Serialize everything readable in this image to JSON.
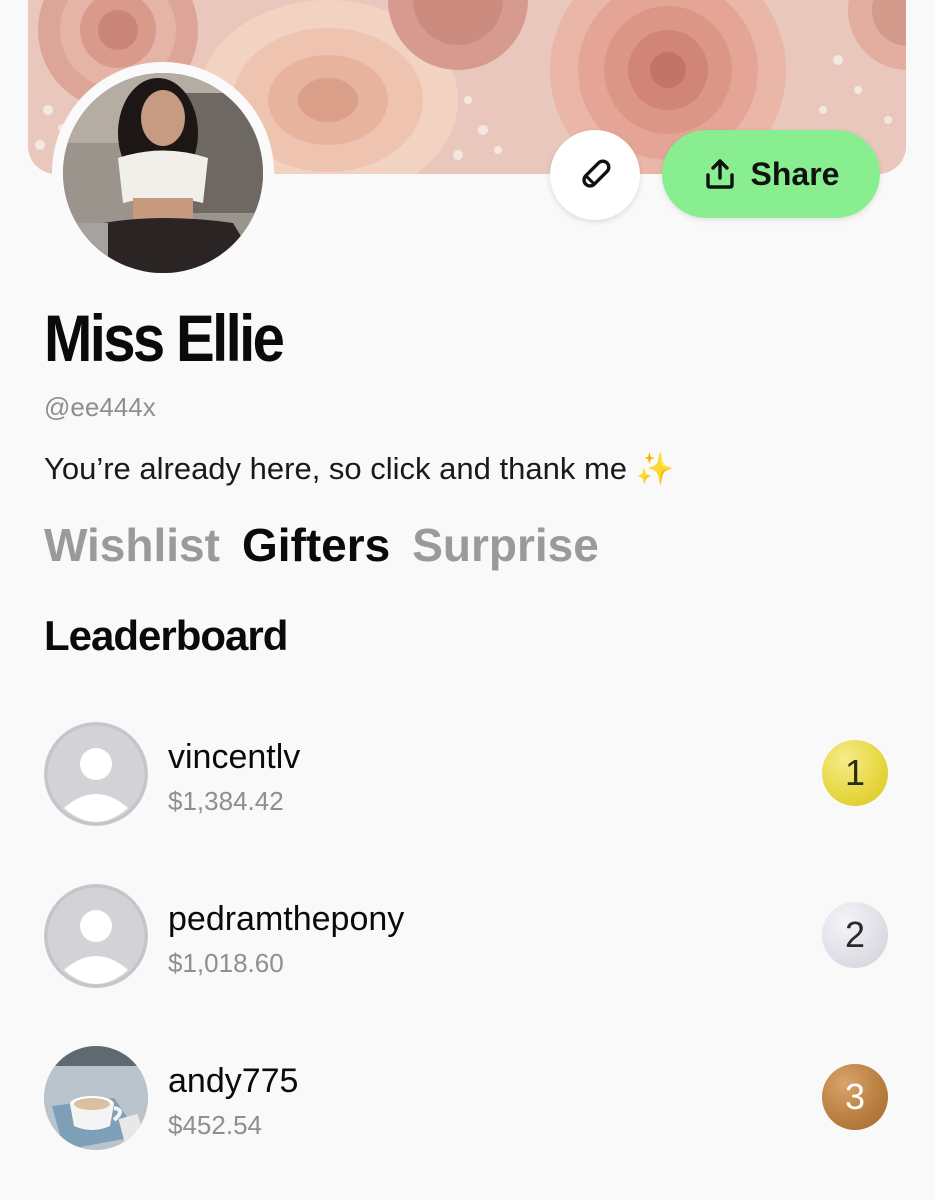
{
  "profile": {
    "name": "Miss Ellie",
    "handle": "@ee444x",
    "bio": "You’re already here, so click and thank me",
    "bio_emoji": "✨"
  },
  "actions": {
    "edit_icon": "pencil-icon",
    "share_icon": "share-upload-icon",
    "share_label": "Share"
  },
  "tabs": [
    {
      "label": "Wishlist",
      "active": false
    },
    {
      "label": "Gifters",
      "active": true
    },
    {
      "label": "Surprise",
      "active": false
    }
  ],
  "leaderboard": {
    "title": "Leaderboard",
    "entries": [
      {
        "username": "vincentlv",
        "amount": "$1,384.42",
        "rank": "1",
        "avatar": "default-person-icon"
      },
      {
        "username": "pedramthepony",
        "amount": "$1,018.60",
        "rank": "2",
        "avatar": "default-person-icon"
      },
      {
        "username": "andy775",
        "amount": "$452.54",
        "rank": "3",
        "avatar": "coffee-cup-photo"
      }
    ]
  },
  "colors": {
    "share_button": "#88ee90",
    "gold": "#e6d63e",
    "silver": "#dedfe6",
    "bronze": "#b87c3e",
    "muted_text": "#8e8e93"
  }
}
